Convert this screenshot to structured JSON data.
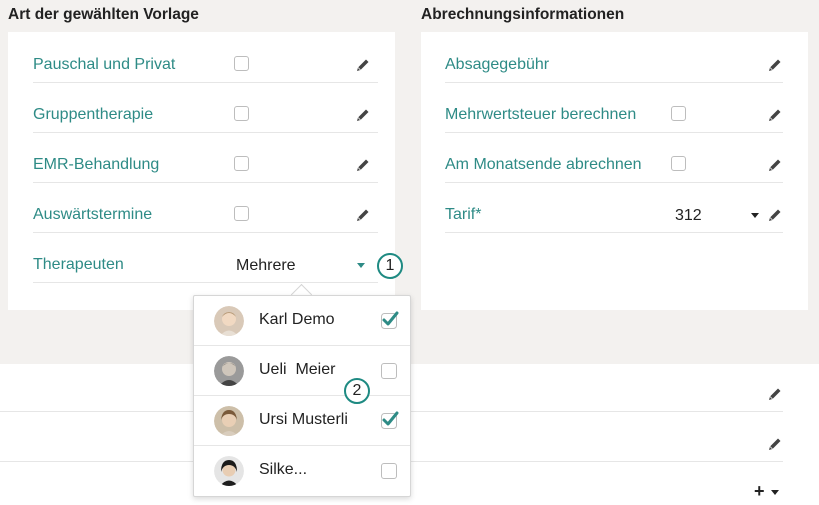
{
  "left_panel": {
    "title": "Art der gewählten Vorlage",
    "rows": [
      {
        "label": "Pauschal und Privat",
        "checked": false
      },
      {
        "label": "Gruppentherapie",
        "checked": false
      },
      {
        "label": "EMR-Behandlung",
        "checked": false
      },
      {
        "label": "Auswärtstermine",
        "checked": false
      }
    ],
    "therapists": {
      "label": "Therapeuten",
      "value": "Mehrere"
    }
  },
  "right_panel": {
    "title": "Abrechnungsinformationen",
    "rows": [
      {
        "label": "Absagegebühr"
      },
      {
        "label": "Mehrwertsteuer berechnen",
        "checked": false
      },
      {
        "label": "Am Monatsende abrechnen",
        "checked": false
      }
    ],
    "tarif": {
      "label": "Tarif*",
      "value": "312"
    }
  },
  "badges": [
    "1",
    "2"
  ],
  "dropdown": {
    "items": [
      {
        "name": "Karl Demo",
        "checked": true
      },
      {
        "name": "Ueli  Meier",
        "checked": false
      },
      {
        "name": "Ursi Musterli",
        "checked": true
      },
      {
        "name": "Silke...",
        "checked": false
      }
    ]
  },
  "bottom": {
    "add_label": "+"
  },
  "colors": {
    "accent": "#2e8b86",
    "badge_border": "#1e8a82",
    "background": "#f3f1ef"
  }
}
